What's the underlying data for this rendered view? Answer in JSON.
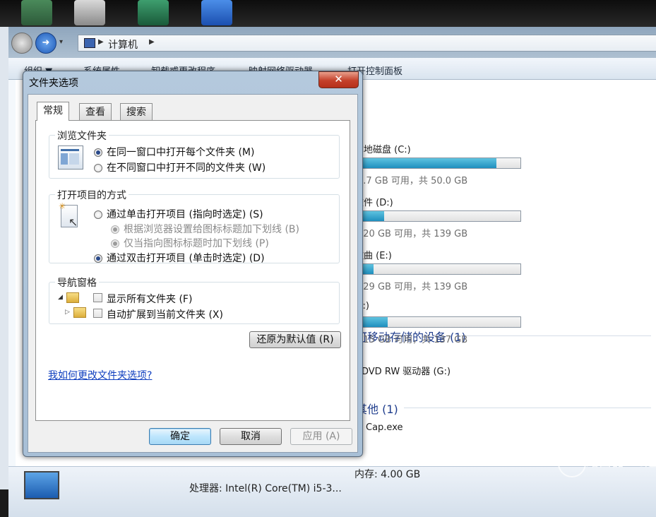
{
  "breadcrumb": {
    "location": "计算机"
  },
  "toolbar": {
    "organize": "组织 ▼",
    "system_properties": "系统属性",
    "uninstall": "卸载或更改程序",
    "map_drive": "映射网络驱动器",
    "control_panel": "打开控制面板"
  },
  "drives": [
    {
      "label": "本地磁盘 (C:)",
      "free": "7.7 GB 可用，共 50.0 GB",
      "used_fraction": 0.85
    },
    {
      "label": "软件 (D:)",
      "free": "120 GB 可用，共 139 GB",
      "used_fraction": 0.14
    },
    {
      "label": "歌曲 (E:)",
      "free": "129 GB 可用，共 139 GB",
      "used_fraction": 0.07
    },
    {
      "label": "(F:)",
      "free": "115 GB 可用，共 137 GB",
      "used_fraction": 0.16
    }
  ],
  "sections": {
    "removable": "可移动存储的设备 (1)",
    "dvd": "DVD RW 驱动器 (G:)",
    "other": "其他 (1)",
    "other_item": "Cap.exe"
  },
  "details": {
    "memory": "内存: 4.00 GB",
    "processor": "处理器: Intel(R) Core(TM) i5-3..."
  },
  "dialog": {
    "title": "文件夹选项",
    "close": "✕",
    "tabs": [
      "常规",
      "查看",
      "搜索"
    ],
    "browse": {
      "title": "浏览文件夹",
      "same_window": "在同一窗口中打开每个文件夹 (M)",
      "new_window": "在不同窗口中打开不同的文件夹 (W)"
    },
    "click": {
      "title": "打开项目的方式",
      "single": "通过单击打开项目 (指向时选定) (S)",
      "underline_browser": "根据浏览器设置给图标标题加下划线 (B)",
      "underline_point": "仅当指向图标标题时加下划线 (P)",
      "double": "通过双击打开项目 (单击时选定) (D)"
    },
    "nav": {
      "title": "导航窗格",
      "show_all": "显示所有文件夹 (F)",
      "auto_expand": "自动扩展到当前文件夹 (X)"
    },
    "restore": "还原为默认值 (R)",
    "help_link": "我如何更改文件夹选项?",
    "ok": "确定",
    "cancel": "取消",
    "apply": "应用 (A)"
  },
  "watermark": "路由器 PC速递"
}
